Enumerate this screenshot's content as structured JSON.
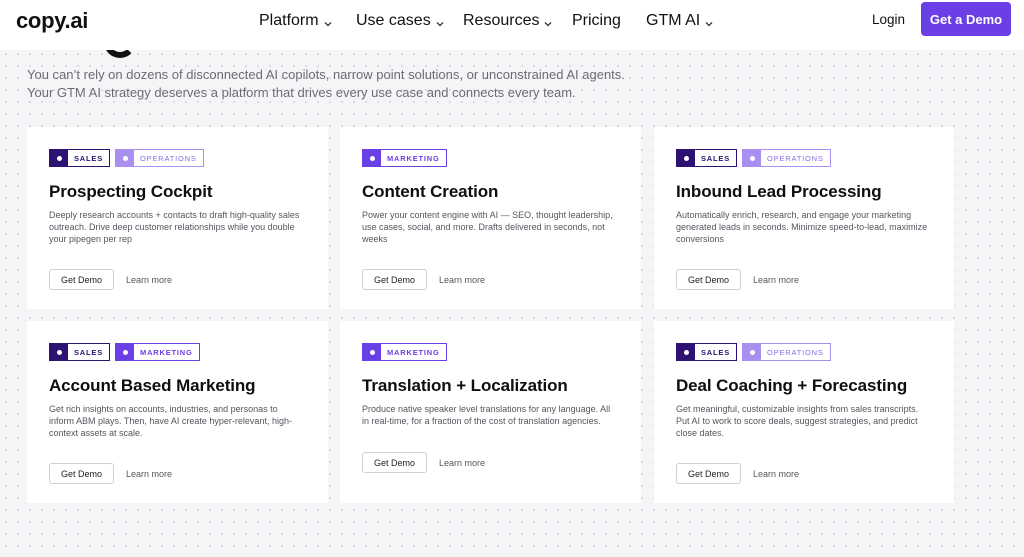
{
  "brand": {
    "logo": "copy.ai",
    "accent": "#6b3fe6"
  },
  "nav": {
    "items": [
      {
        "label": "Platform",
        "dropdown": true
      },
      {
        "label": "Use cases",
        "dropdown": true
      },
      {
        "label": "Resources",
        "dropdown": true
      },
      {
        "label": "Pricing",
        "dropdown": false
      },
      {
        "label": "GTM AI",
        "dropdown": true
      }
    ],
    "login": "Login",
    "cta": "Get a Demo"
  },
  "intro": {
    "line1": "You can’t rely on dozens of disconnected AI copilots, narrow point solutions, or unconstrained AI agents.",
    "line2": "Your GTM AI strategy deserves a platform that drives every use case and connects every team."
  },
  "cards": [
    {
      "tags": [
        {
          "label": "SALES",
          "kind": "sales"
        },
        {
          "label": "OPERATIONS",
          "kind": "operations"
        }
      ],
      "title": "Prospecting Cockpit",
      "desc": "Deeply research accounts + contacts to draft high-quality sales outreach. Drive deep customer relationships while you double your pipegen per rep",
      "demo": "Get Demo",
      "learn": "Learn more"
    },
    {
      "tags": [
        {
          "label": "MARKETING",
          "kind": "marketing"
        }
      ],
      "title": "Content Creation",
      "desc": "Power your content engine with AI — SEO, thought leadership, use cases, social, and more. Drafts delivered in seconds, not weeks",
      "demo": "Get Demo",
      "learn": "Learn more"
    },
    {
      "tags": [
        {
          "label": "SALES",
          "kind": "sales"
        },
        {
          "label": "OPERATIONS",
          "kind": "operations"
        }
      ],
      "title": "Inbound Lead Processing",
      "desc": "Automatically enrich, research, and engage your marketing generated leads in seconds. Minimize speed-to-lead, maximize conversions",
      "demo": "Get Demo",
      "learn": "Learn more"
    },
    {
      "tags": [
        {
          "label": "SALES",
          "kind": "sales"
        },
        {
          "label": "MARKETING",
          "kind": "marketing"
        }
      ],
      "title": "Account Based Marketing",
      "desc": "Get rich insights on accounts, industries, and personas to inform ABM plays. Then, have AI create hyper-relevant, high-context assets at scale.",
      "demo": "Get Demo",
      "learn": "Learn more"
    },
    {
      "tags": [
        {
          "label": "MARKETING",
          "kind": "marketing"
        }
      ],
      "title": "Translation + Localization",
      "desc": "Produce native speaker level translations for any language. All in real-time, for a fraction of the cost of translation agencies.",
      "demo": "Get Demo",
      "learn": "Learn more"
    },
    {
      "tags": [
        {
          "label": "SALES",
          "kind": "sales"
        },
        {
          "label": "OPERATIONS",
          "kind": "operations"
        }
      ],
      "title": "Deal Coaching + Forecasting",
      "desc": "Get meaningful, customizable insights from sales transcripts. Put AI to work to score deals, suggest strategies, and predict close dates.",
      "demo": "Get Demo",
      "learn": "Learn more"
    }
  ]
}
